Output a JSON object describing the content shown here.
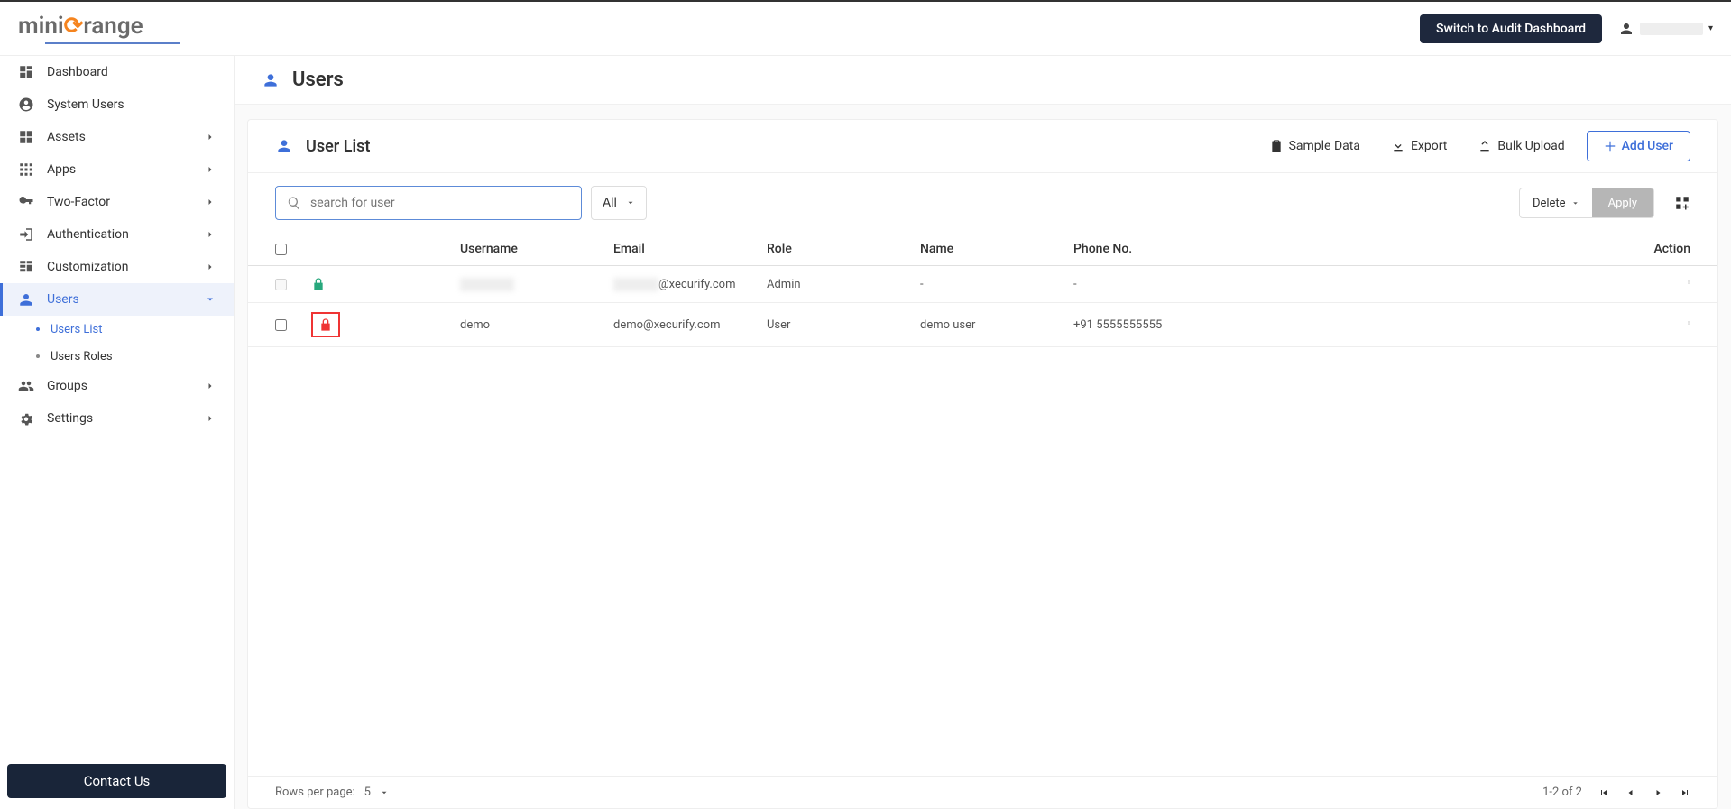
{
  "header": {
    "logo_mini": "mini",
    "logo_o": "o",
    "logo_range": "range",
    "switch_btn": "Switch to Audit Dashboard"
  },
  "sidebar": {
    "items": [
      {
        "label": "Dashboard"
      },
      {
        "label": "System Users"
      },
      {
        "label": "Assets"
      },
      {
        "label": "Apps"
      },
      {
        "label": "Two-Factor"
      },
      {
        "label": "Authentication"
      },
      {
        "label": "Customization"
      },
      {
        "label": "Users"
      },
      {
        "label": "Groups"
      },
      {
        "label": "Settings"
      }
    ],
    "users_sub": [
      {
        "label": "Users List"
      },
      {
        "label": "Users Roles"
      }
    ],
    "contact_label": "Contact Us"
  },
  "page": {
    "title": "Users",
    "panel_title": "User List"
  },
  "panel_actions": {
    "sample": "Sample Data",
    "export": "Export",
    "bulk": "Bulk Upload",
    "add": "Add User"
  },
  "toolbar": {
    "search_placeholder": "search for user",
    "filter": "All",
    "bulk_action": "Delete",
    "apply": "Apply"
  },
  "table": {
    "headers": {
      "username": "Username",
      "email": "Email",
      "role": "Role",
      "name": "Name",
      "phone": "Phone No.",
      "action": "Action"
    },
    "rows": [
      {
        "lock": "unlocked",
        "username_redacted": true,
        "username": "",
        "email": "@xecurify.com",
        "email_redacted": true,
        "role": "Admin",
        "name": "-",
        "phone": "-"
      },
      {
        "lock": "locked",
        "lock_highlight": true,
        "username": "demo",
        "email": "demo@xecurify.com",
        "role": "User",
        "name": "demo user",
        "phone": "+91 5555555555"
      }
    ]
  },
  "footer": {
    "rows_label": "Rows per page:",
    "rows_value": "5",
    "page_status": "1-2 of 2"
  }
}
